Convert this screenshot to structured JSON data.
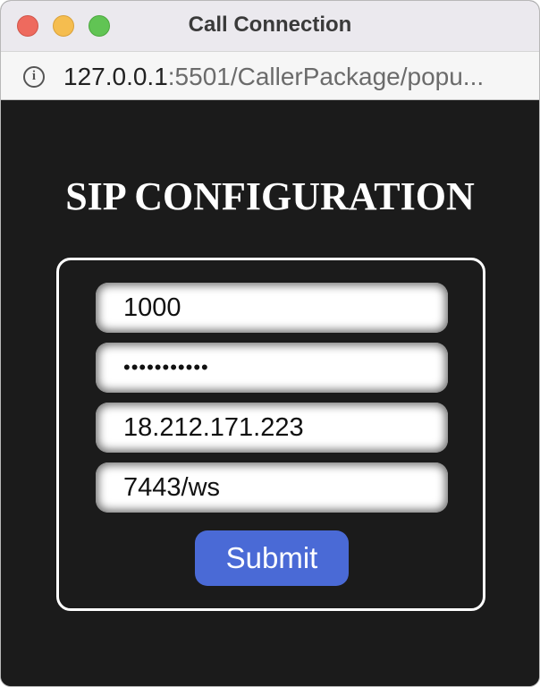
{
  "window": {
    "title": "Call Connection",
    "address_host": "127.0.0.1",
    "address_rest": ":5501/CallerPackage/popu..."
  },
  "page": {
    "heading": "SIP CONFIGURATION"
  },
  "form": {
    "extension_value": "1000",
    "password_value": "•••••••••••",
    "server_value": "18.212.171.223",
    "port_value": "7443/ws",
    "submit_label": "Submit"
  },
  "colors": {
    "background": "#1b1b1b",
    "accent": "#4a6ad6",
    "text": "#ffffff"
  },
  "icons": {
    "address_info": "info-icon"
  }
}
